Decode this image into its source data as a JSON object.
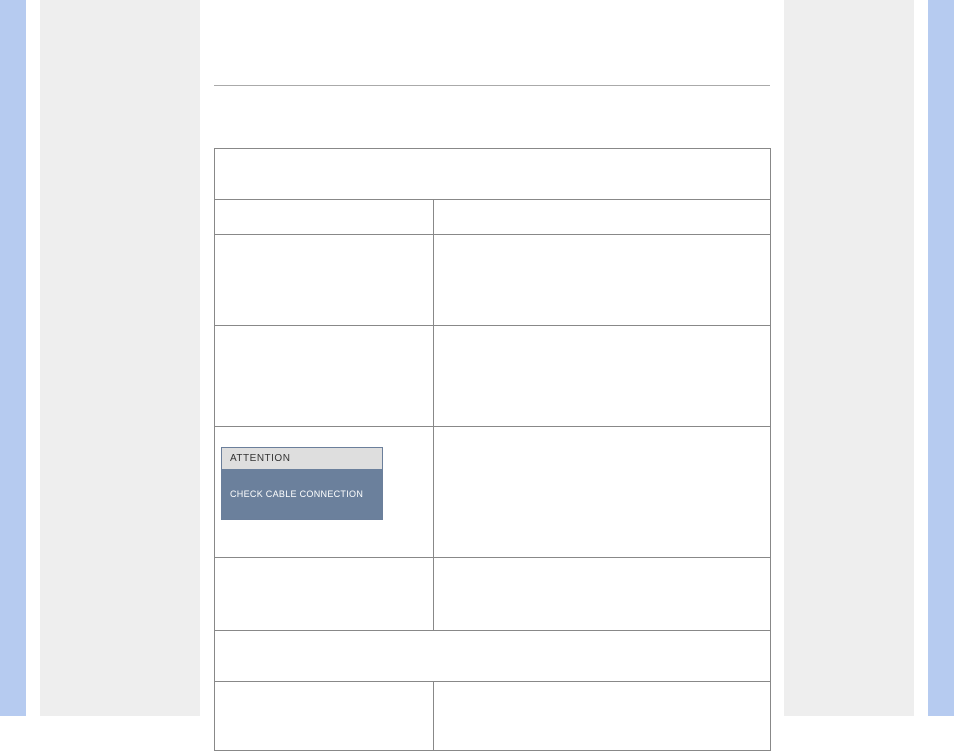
{
  "dialog": {
    "title": "ATTENTION",
    "body": "CHECK CABLE CONNECTION"
  }
}
